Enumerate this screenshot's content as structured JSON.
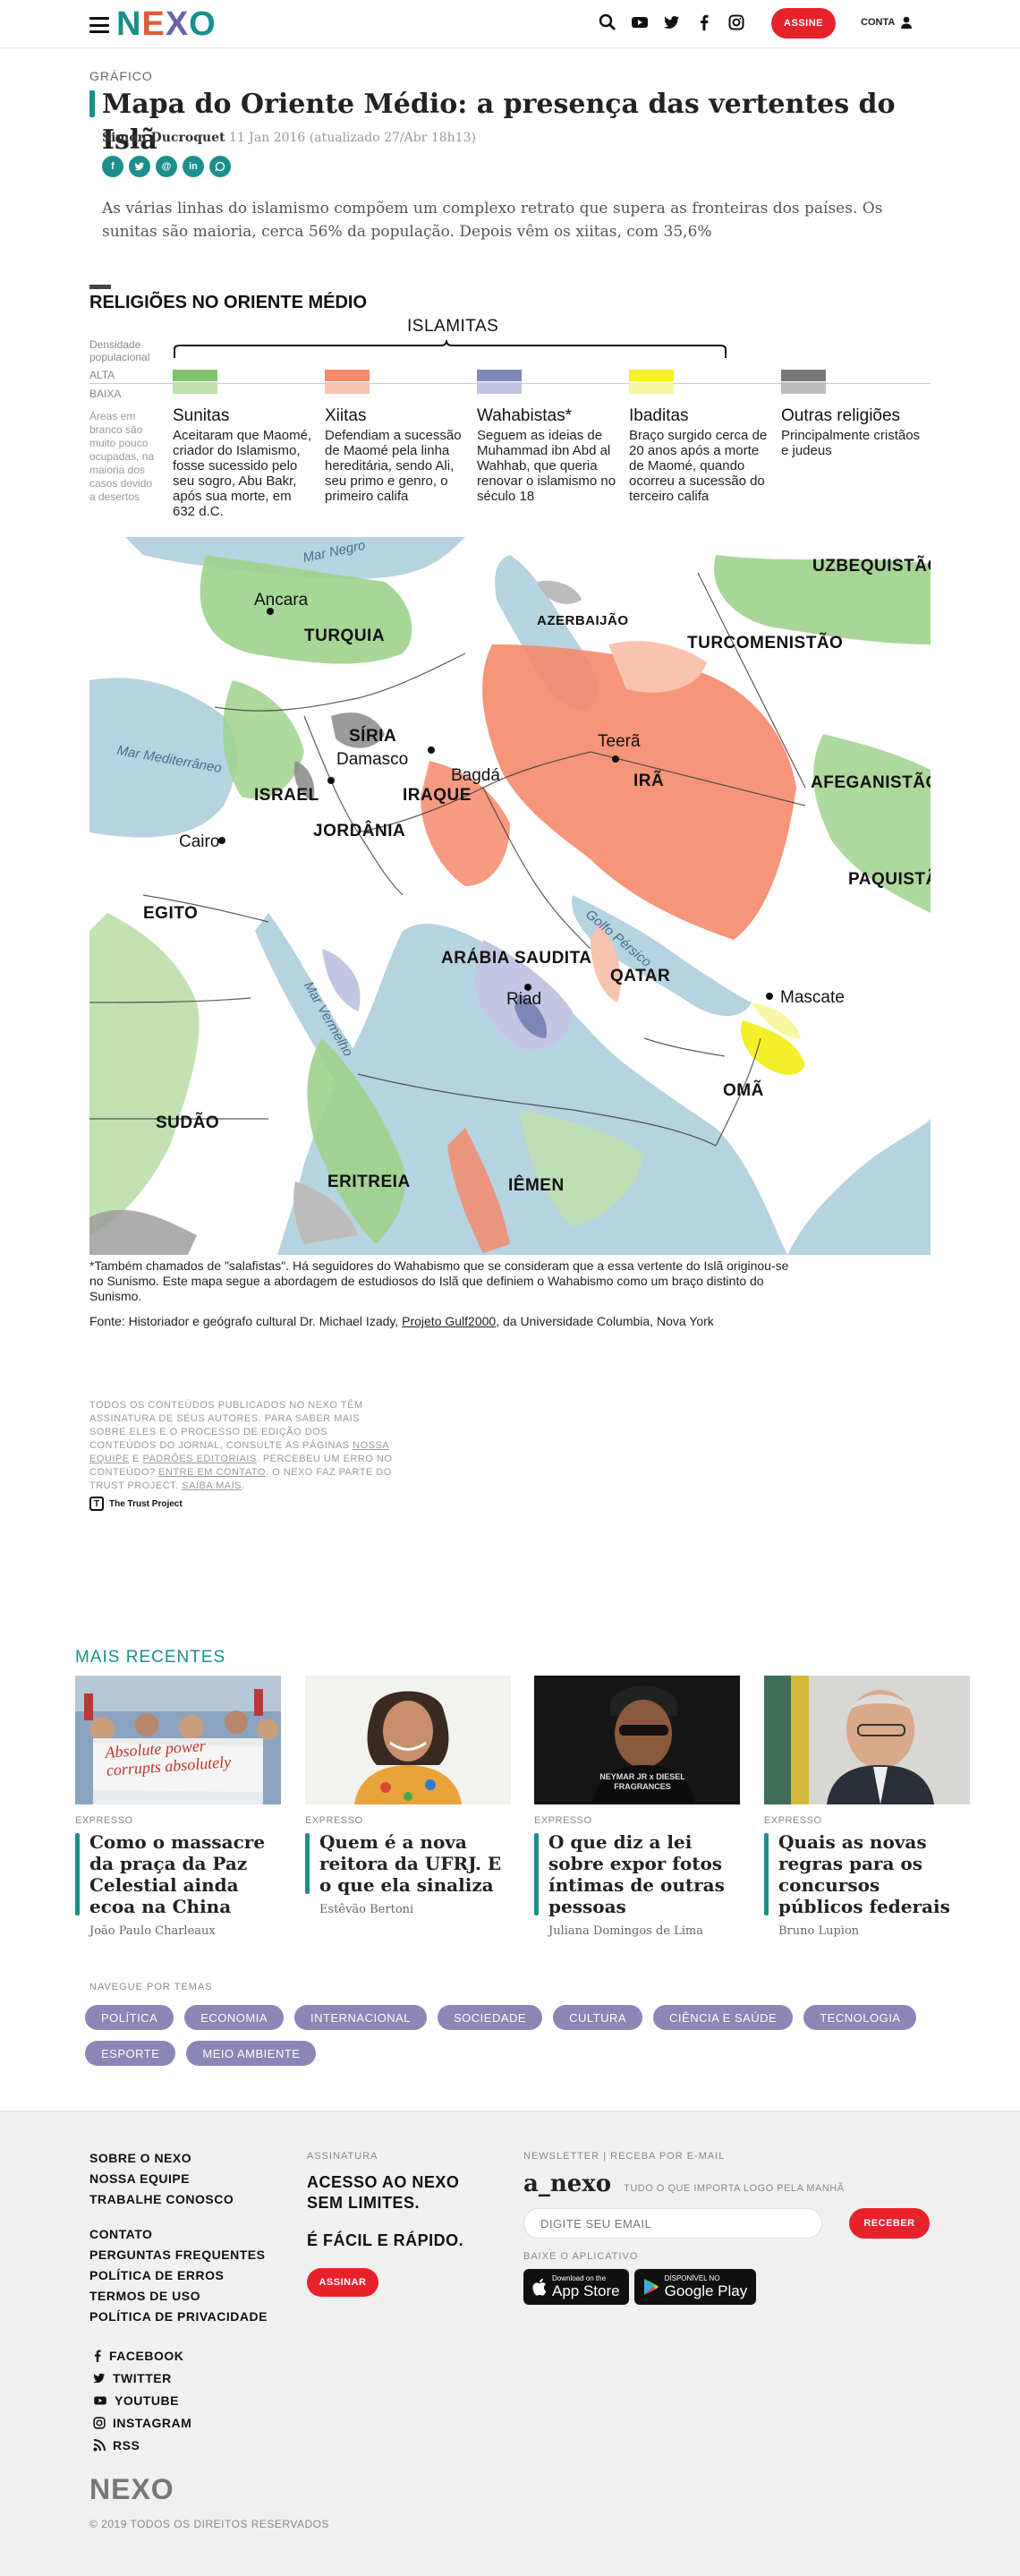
{
  "header": {
    "logo": "NEXO",
    "assine_label": "ASSINE",
    "conta_label": "CONTA"
  },
  "article": {
    "kicker": "GRÁFICO",
    "title": "Mapa do Oriente Médio: a presença das vertentes do Islã",
    "author": "Simon Ducroquet",
    "date": "11 Jan 2016",
    "updated": "(atualizado 27/Abr 18h13)",
    "lead": "As várias linhas do islamismo compõem um complexo retrato que supera as fronteiras dos países. Os sunitas são maioria, cerca 56% da população. Depois vêm os xiitas, com 35,6%"
  },
  "infographic": {
    "title": "RELIGIÕES NO ORIENTE MÉDIO",
    "group_label": "ISLAMITAS",
    "density_label": "Densidade populacional",
    "alta": "ALTA",
    "baixa": "BAIXA",
    "blank_note": "Áreas em branco são muito pouco ocupadas, na maioria dos casos devido a desertos",
    "legend": [
      {
        "name": "Sunitas",
        "desc": "Aceitaram que Maomé, criador do Islamismo, fosse sucessido pelo seu sogro, Abu Bakr, após sua morte, em 632 d.C.",
        "color_high": "#7cc36b",
        "color_low": "#bfe0b0"
      },
      {
        "name": "Xiitas",
        "desc": "Defendiam a sucessão de Maomé pela linha hereditária, sendo Ali, seu primo e genro, o primeiro califa",
        "color_high": "#f58a6c",
        "color_low": "#f9c3b0"
      },
      {
        "name": "Wahabistas*",
        "desc": "Seguem as ideias de Muhammad ibn Abd al Wahhab, que queria renovar o islamismo no século 18",
        "color_high": "#7d86b8",
        "color_low": "#c3c6e2"
      },
      {
        "name": "Ibaditas",
        "desc": "Braço surgido cerca de 20 anos após a morte de Maomé, quando ocorreu a sucessão do terceiro califa",
        "color_high": "#f5ef2a",
        "color_low": "#faf7a2"
      },
      {
        "name": "Outras religiões",
        "desc": "Principalmente cristãos e judeus",
        "color_high": "#777777",
        "color_low": "#bcbcbc"
      }
    ],
    "map_labels": {
      "countries": [
        "UZBEQUISTÃO",
        "TURQUIA",
        "AZERBAIJÃO",
        "TURCOMENISTÃO",
        "SÍRIA",
        "ISRAEL",
        "IRAQUE",
        "IRÃ",
        "AFEGANISTÃO",
        "JORDÂNIA",
        "PAQUISTÃ",
        "EGITO",
        "ARÁBIA SAUDITA",
        "QATAR",
        "OMÃ",
        "SUDÃO",
        "ERITREIA",
        "IÊMEN"
      ],
      "cities": [
        "Ancara",
        "Damasco",
        "Bagdá",
        "Teerã",
        "Cairo",
        "Riad",
        "Mascate"
      ],
      "seas": [
        "Mar Negro",
        "Mar Mediterrâneo",
        "Golfo Pérsico",
        "Mar Vermelho"
      ]
    },
    "footnote": "*Também chamados de \"salafistas\". Há seguidores do Wahabismo que se consideram que a essa vertente do Islã originou-se no Sunismo. Este mapa segue a abordagem de estudiosos do Islã que definiem o Wahabismo como um braço distinto do Sunismo.",
    "source_prefix": "Fonte: Historiador e geógrafo cultural Dr. Michael Izady, ",
    "source_link": "Projeto Gulf2000",
    "source_suffix": ", da Universidade Columbia, Nova York"
  },
  "trust": {
    "text1": "TODOS OS CONTEÚDOS PUBLICADOS NO NEXO TÊM ASSINATURA DE SEUS AUTORES. PARA SABER MAIS SOBRE ELES E O PROCESSO DE EDIÇÃO DOS CONTEÚDOS DO JORNAL, CONSULTE AS PÁGINAS ",
    "link1": "NOSSA EQUIPE",
    "text2": " E ",
    "link2": "PADRÕES EDITORIAIS",
    "text3": ". PERCEBEU UM ERRO NO CONTEÚDO? ",
    "link3": "ENTRE EM CONTATO",
    "text4": ". O NEXO FAZ PARTE DO TRUST PROJECT. ",
    "link4": "SAIBA MAIS",
    "text5": ".",
    "logo_text": "The Trust Project"
  },
  "recent": {
    "title": "MAIS RECENTES",
    "items": [
      {
        "cat": "EXPRESSO",
        "headline": "Como o massacre da praça da Paz Celestial ainda ecoa na China",
        "author": "João Paulo Charleaux",
        "banner": "Absolute power corrupts absolutely"
      },
      {
        "cat": "EXPRESSO",
        "headline": "Quem é a nova reitora da UFRJ. E o que ela sinaliza",
        "author": "Estêvão Bertoni"
      },
      {
        "cat": "EXPRESSO",
        "headline": "O que diz a lei sobre expor fotos íntimas de outras pessoas",
        "author": "Juliana Domingos de Lima",
        "banner": "NEYMAR JR x DIESEL FRAGRANCES"
      },
      {
        "cat": "EXPRESSO",
        "headline": "Quais as novas regras para os concursos públicos federais",
        "author": "Bruno Lupion"
      }
    ]
  },
  "temas": {
    "label": "NAVEGUE POR TEMAS",
    "tags": [
      "POLÍTICA",
      "ECONOMIA",
      "INTERNACIONAL",
      "SOCIEDADE",
      "CULTURA",
      "CIÊNCIA E SAÚDE",
      "TECNOLOGIA",
      "ESPORTE",
      "MEIO AMBIENTE"
    ]
  },
  "footer": {
    "links1": [
      "SOBRE O NEXO",
      "NOSSA EQUIPE",
      "TRABALHE CONOSCO"
    ],
    "links2": [
      "CONTATO",
      "PERGUNTAS FREQUENTES",
      "POLÍTICA DE ERROS",
      "TERMOS DE USO",
      "POLÍTICA DE PRIVACIDADE"
    ],
    "social": [
      "FACEBOOK",
      "TWITTER",
      "YOUTUBE",
      "INSTAGRAM",
      "RSS"
    ],
    "assinatura_label": "ASSINATURA",
    "assinatura_big": "ACESSO AO NEXO SEM LIMITES.",
    "assinatura_big2": "É FÁCIL E RÁPIDO.",
    "assinar_btn": "ASSINAR",
    "newsletter_label": "NEWSLETTER | RECEBA POR E-MAIL",
    "anexo": "a_nexo",
    "anexo_tag": "TUDO O QUE IMPORTA LOGO PELA MANHÃ",
    "email_placeholder": "DIGITE SEU EMAIL",
    "receber_btn": "RECEBER",
    "app_label": "BAIXE O APLICATIVO",
    "appstore_small": "Download on the",
    "appstore_big": "App Store",
    "gplay_small": "DISPONÍVEL NO",
    "gplay_big": "Google Play",
    "logo": "NEXO",
    "copyright": "© 2019 TODOS OS DIREITOS RESERVADOS"
  }
}
